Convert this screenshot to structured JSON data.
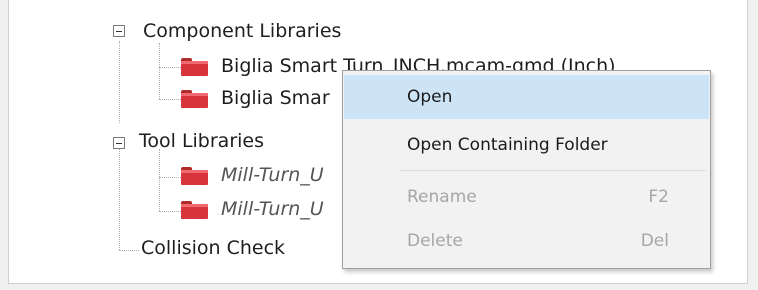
{
  "tree": {
    "component_libraries": {
      "label": "Component Libraries",
      "items": [
        "Biglia Smart Turn_INCH.mcam-gmd (Inch)",
        "Biglia Smar"
      ]
    },
    "tool_libraries": {
      "label": "Tool Libraries",
      "items": [
        "Mill-Turn_U",
        "Mill-Turn_U"
      ]
    },
    "collision_check": {
      "label": "Collision Check"
    }
  },
  "context_menu": {
    "items": [
      {
        "label": "Open",
        "shortcut": "",
        "enabled": true,
        "highlighted": true
      },
      {
        "label": "Open Containing Folder",
        "shortcut": "",
        "enabled": true
      },
      {
        "label": "Rename",
        "shortcut": "F2",
        "enabled": false
      },
      {
        "label": "Delete",
        "shortcut": "Del",
        "enabled": false
      }
    ]
  },
  "colors": {
    "folder_red": "#d8343b",
    "menu_highlight": "#cde4f7",
    "menu_background": "#f2f2f2"
  },
  "icons": {
    "expander": "collapse-minus-icon",
    "library_item": "red-folder-icon"
  }
}
